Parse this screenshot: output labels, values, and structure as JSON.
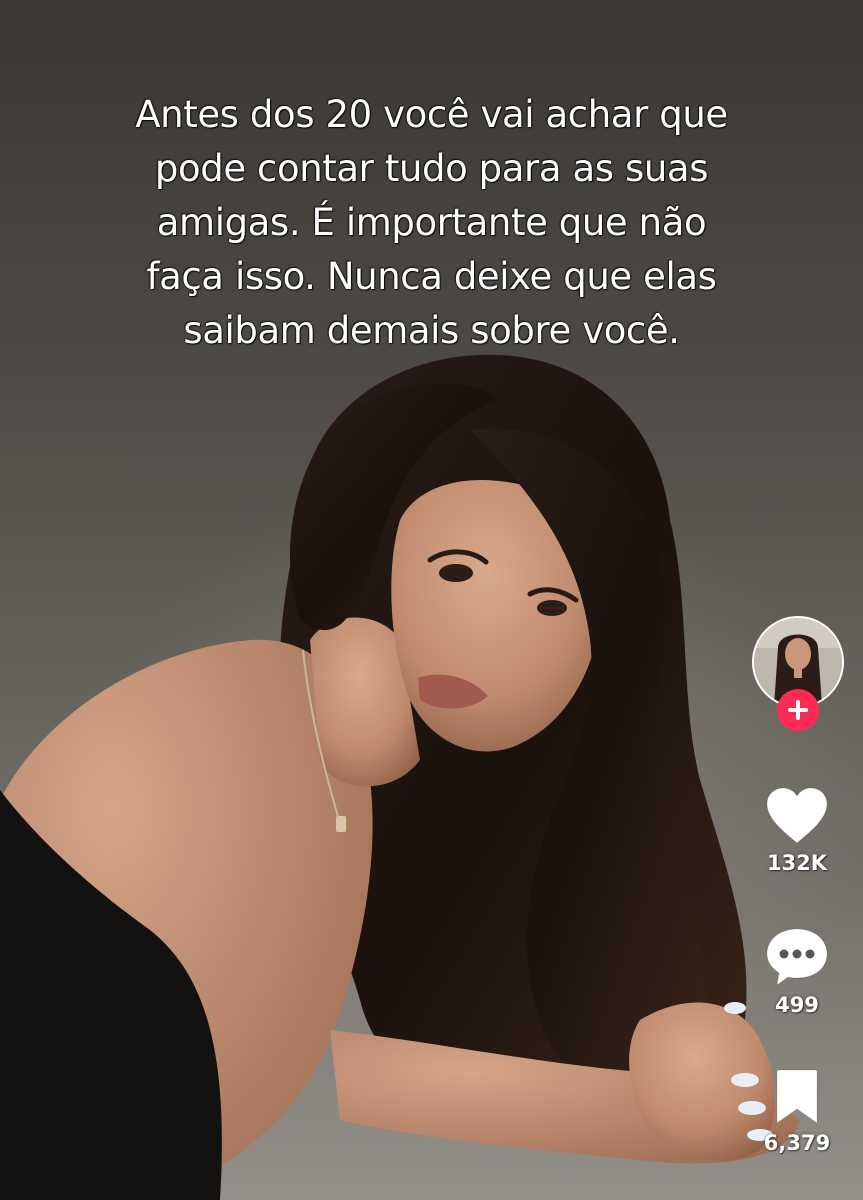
{
  "video": {
    "caption_lines": [
      "Antes dos 20 você vai achar que",
      "pode contar tudo para as suas",
      "amigas. É importante que não",
      "faça isso. Nunca deixe que elas",
      "saibam demais sobre você."
    ]
  },
  "actions": {
    "follow_icon": "plus-icon",
    "like": {
      "icon": "heart-icon",
      "count": "132K"
    },
    "comment": {
      "icon": "comment-bubble-icon",
      "count": "499"
    },
    "save": {
      "icon": "bookmark-icon",
      "count": "6,379"
    }
  },
  "colors": {
    "follow_accent": "#fe2c55",
    "icon_white": "#ffffff"
  }
}
